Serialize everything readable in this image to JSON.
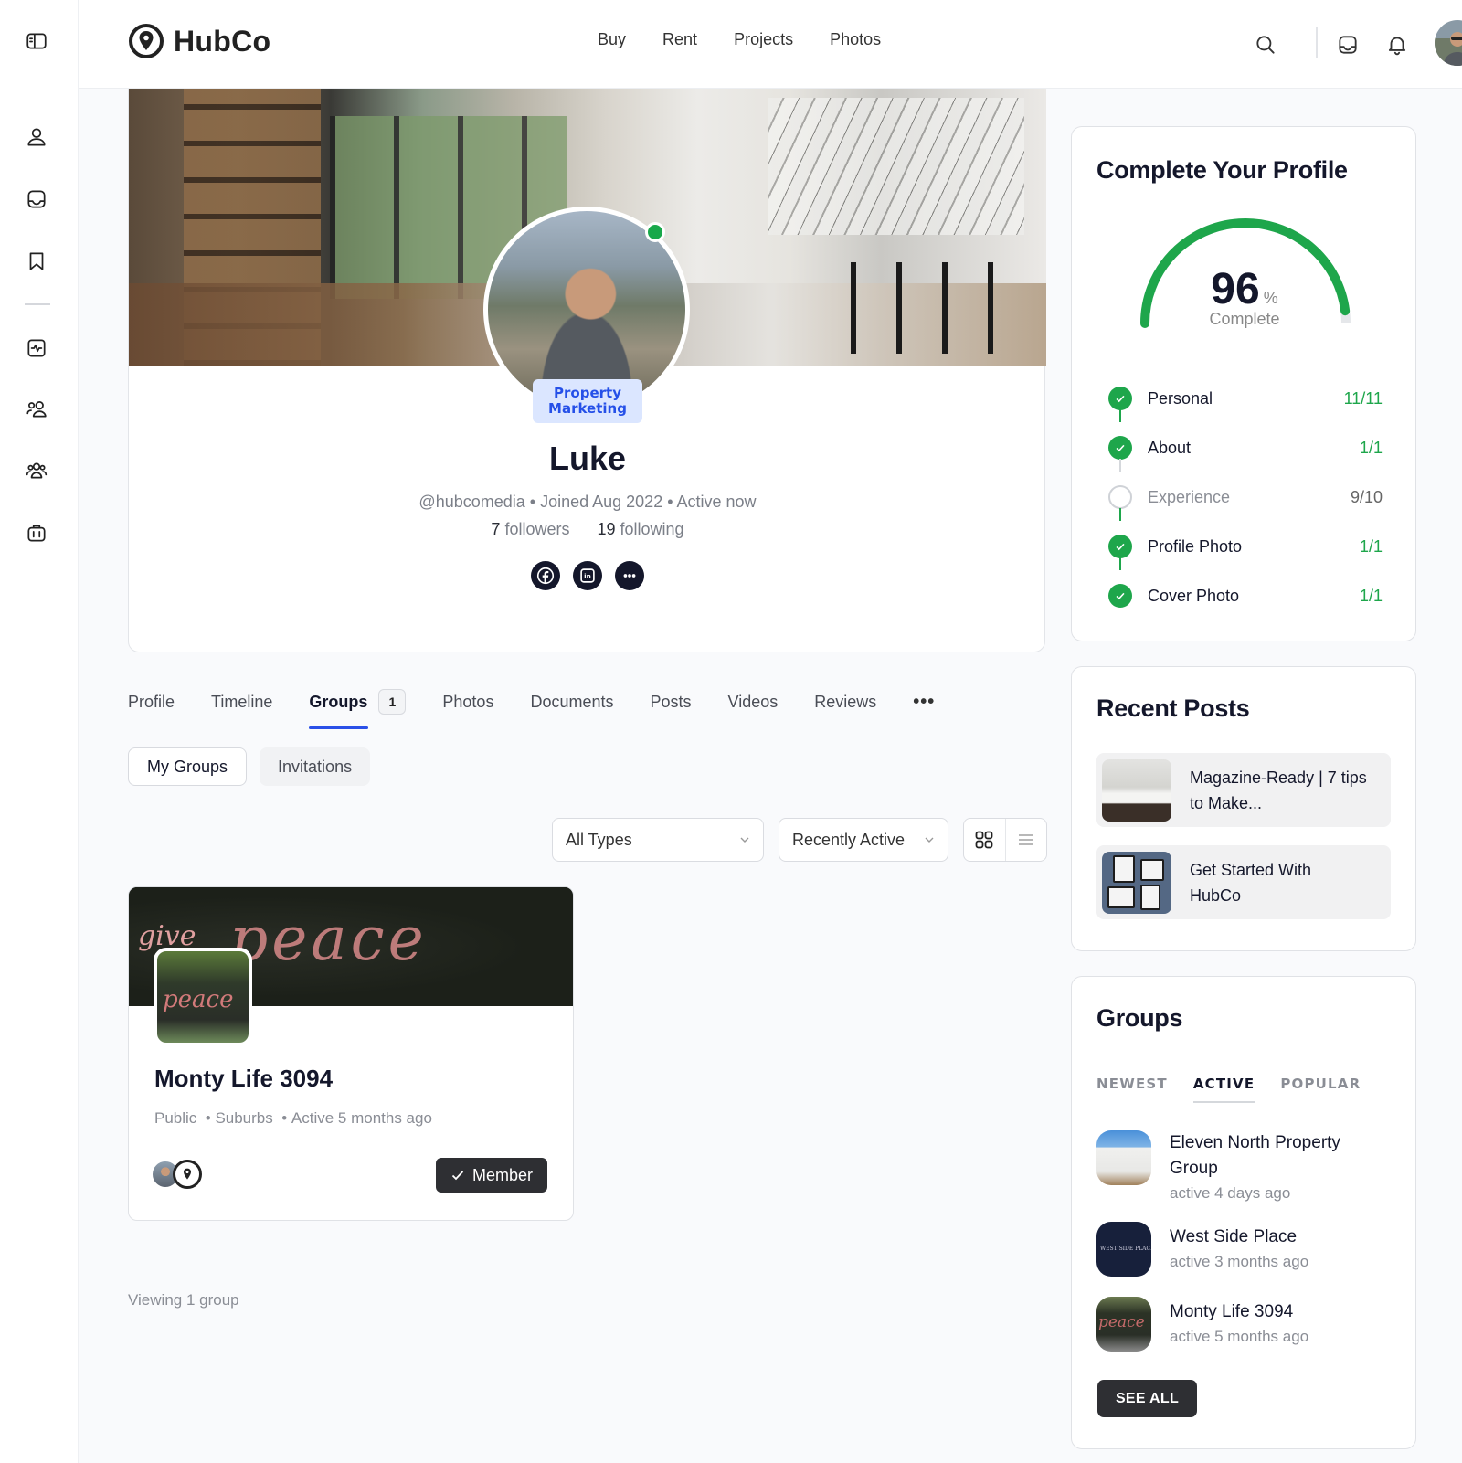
{
  "app": {
    "brand": "HubCo"
  },
  "header": {
    "nav": [
      "Buy",
      "Rent",
      "Projects",
      "Photos"
    ],
    "icons": [
      "search-icon",
      "inbox-icon",
      "bell-icon"
    ]
  },
  "rail": {
    "icons": [
      "sidebar-toggle-icon",
      "profile-icon",
      "inbox-icon",
      "bookmark-icon",
      "activity-icon",
      "connections-icon",
      "groups-icon",
      "briefcase-icon"
    ]
  },
  "profile": {
    "name": "Luke",
    "role_badge_line1": "Property",
    "role_badge_line2": "Marketing",
    "handle": "@hubcomedia",
    "joined": "Joined Aug 2022",
    "status": "Active now",
    "meta_sep": " • ",
    "followers_count": "7",
    "followers_label": "followers",
    "following_count": "19",
    "following_label": "following",
    "online": true,
    "socials": [
      "facebook-icon",
      "linkedin-icon",
      "more-icon"
    ]
  },
  "tabs": {
    "items": [
      {
        "label": "Profile"
      },
      {
        "label": "Timeline"
      },
      {
        "label": "Groups",
        "count": "1",
        "active": true
      },
      {
        "label": "Photos"
      },
      {
        "label": "Documents"
      },
      {
        "label": "Posts"
      },
      {
        "label": "Videos"
      },
      {
        "label": "Reviews"
      }
    ],
    "more": "•••"
  },
  "subtabs": {
    "my_groups": "My Groups",
    "invitations": "Invitations"
  },
  "filters": {
    "type_selected": "All Types",
    "sort_selected": "Recently Active"
  },
  "group_card": {
    "name": "Monty Life 3094",
    "cover_text_small": "give",
    "cover_text_large": "peace",
    "avatar_text": "peace",
    "visibility": "Public",
    "category": "Suburbs",
    "activity": "Active 5 months ago",
    "member_label": "Member"
  },
  "viewing": "Viewing 1 group",
  "complete_profile": {
    "title": "Complete Your Profile",
    "percent": "96",
    "percent_value": 96,
    "percent_sign": "%",
    "label": "Complete",
    "accent": "#1ea64b",
    "steps": [
      {
        "label": "Personal",
        "value": "11/11",
        "done": true
      },
      {
        "label": "About",
        "value": "1/1",
        "done": true
      },
      {
        "label": "Experience",
        "value": "9/10",
        "done": false
      },
      {
        "label": "Profile Photo",
        "value": "1/1",
        "done": true
      },
      {
        "label": "Cover Photo",
        "value": "1/1",
        "done": true
      }
    ]
  },
  "recent_posts": {
    "title": "Recent Posts",
    "items": [
      {
        "title_line1": "Magazine-Ready | 7 tips",
        "title_line2": "to Make..."
      },
      {
        "title_line1": "Get Started With",
        "title_line2": "HubCo"
      }
    ]
  },
  "groups_widget": {
    "title": "Groups",
    "tabs": [
      "NEWEST",
      "ACTIVE",
      "POPULAR"
    ],
    "active_tab": "ACTIVE",
    "items": [
      {
        "name_line1": "Eleven North Property",
        "name_line2": "Group",
        "activity": "active 4 days ago"
      },
      {
        "name_line1": "West Side Place",
        "logo_text": "WEST SIDE PLACE",
        "activity": "active 3 months ago"
      },
      {
        "name_line1": "Monty Life 3094",
        "logo_text": "peace",
        "activity": "active 5 months ago"
      }
    ],
    "see_all": "SEE ALL"
  }
}
